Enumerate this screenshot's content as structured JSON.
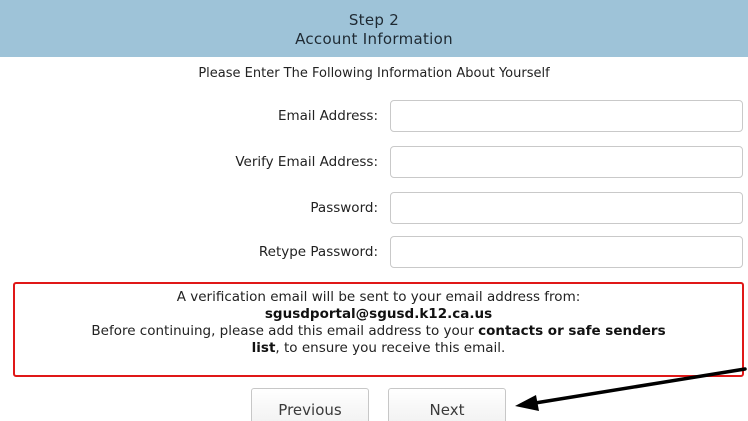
{
  "header": {
    "step": "Step 2",
    "title": "Account Information"
  },
  "intro": "Please Enter The Following Information About Yourself",
  "form": {
    "email_label": "Email Address:",
    "email_value": "",
    "verify_email_label": "Verify Email Address:",
    "verify_email_value": "",
    "password_label": "Password:",
    "password_value": "",
    "retype_password_label": "Retype Password:",
    "retype_password_value": ""
  },
  "notice": {
    "line1": "A verification email will be sent to your email address from:",
    "sender": "sgusdportal@sgusd.k12.ca.us",
    "line3_prefix": "Before continuing, please add this email address to your ",
    "line3_bold": "contacts or safe senders",
    "line4_bold": "list",
    "line4_suffix": ", to ensure you receive this email.",
    "border_color": "#e01818"
  },
  "buttons": {
    "previous": "Previous",
    "next": "Next"
  },
  "colors": {
    "header_bg": "#9ec3d8",
    "annotation_arrow": "#000000"
  },
  "annotation": {
    "icon": "arrow-icon"
  }
}
